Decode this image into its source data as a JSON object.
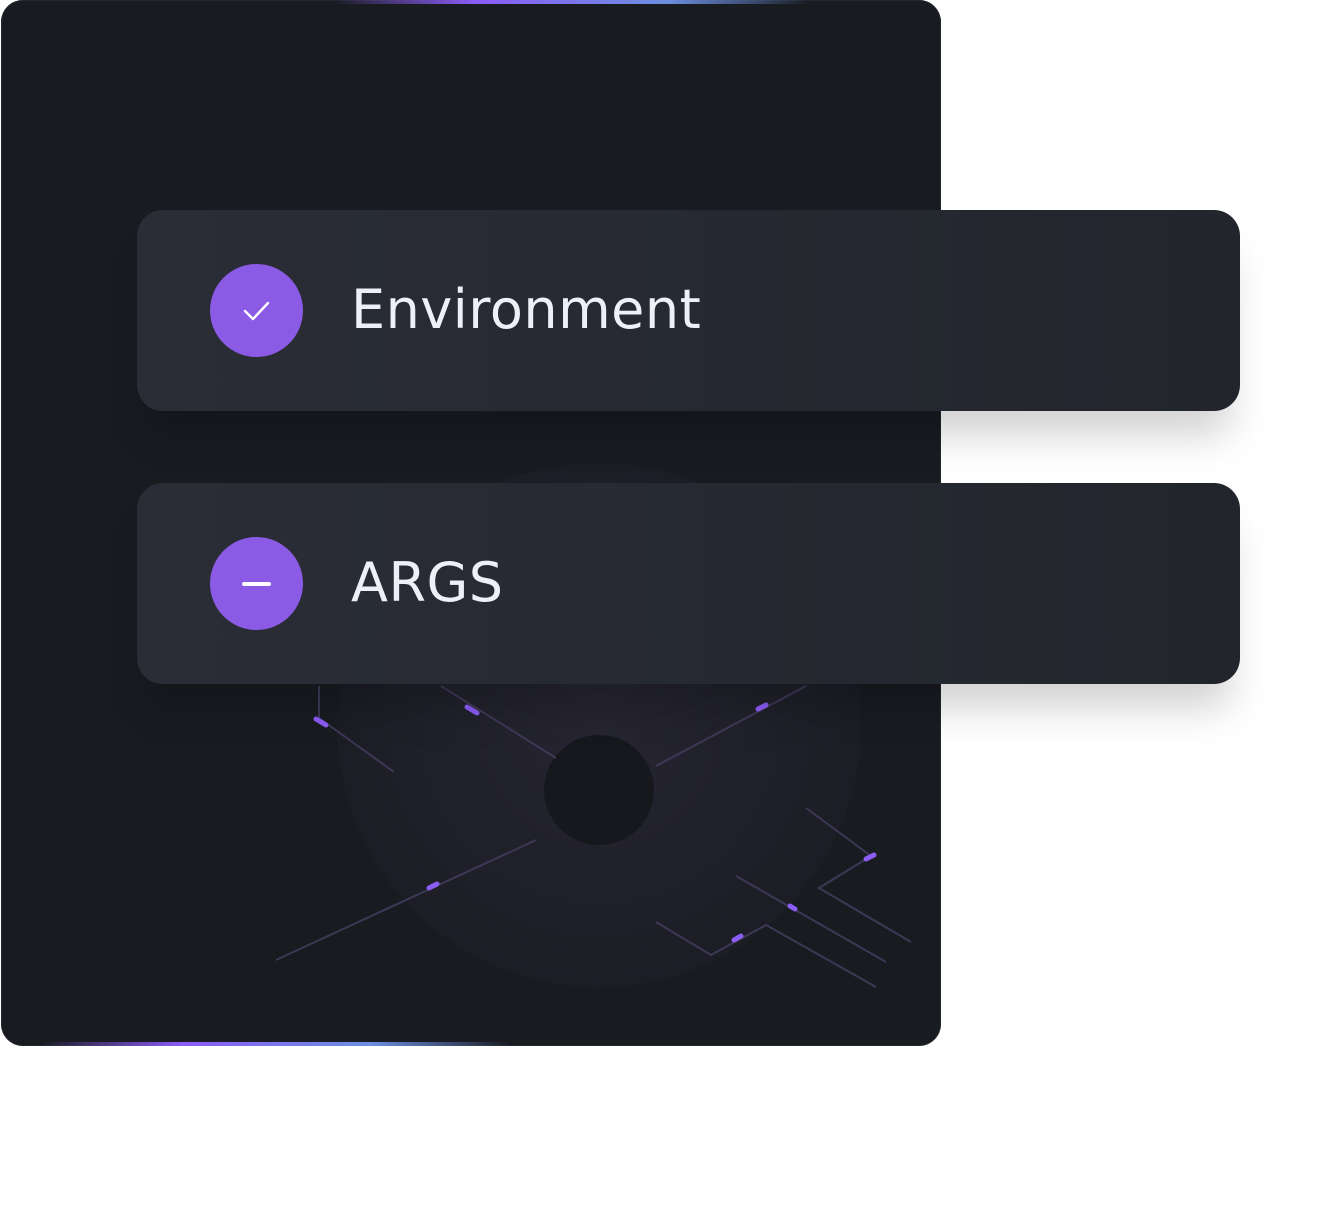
{
  "steps": [
    {
      "label": "Environment",
      "status": "complete",
      "icon": "check-icon"
    },
    {
      "label": "ARGS",
      "status": "in-progress",
      "icon": "minus-icon"
    }
  ],
  "colors": {
    "backdrop": "#181b20",
    "row": "#262931",
    "accent": "#8b5be6",
    "glow_start": "#8b5cf6",
    "glow_end": "#6c8fe0",
    "text": "#eef0f8"
  }
}
